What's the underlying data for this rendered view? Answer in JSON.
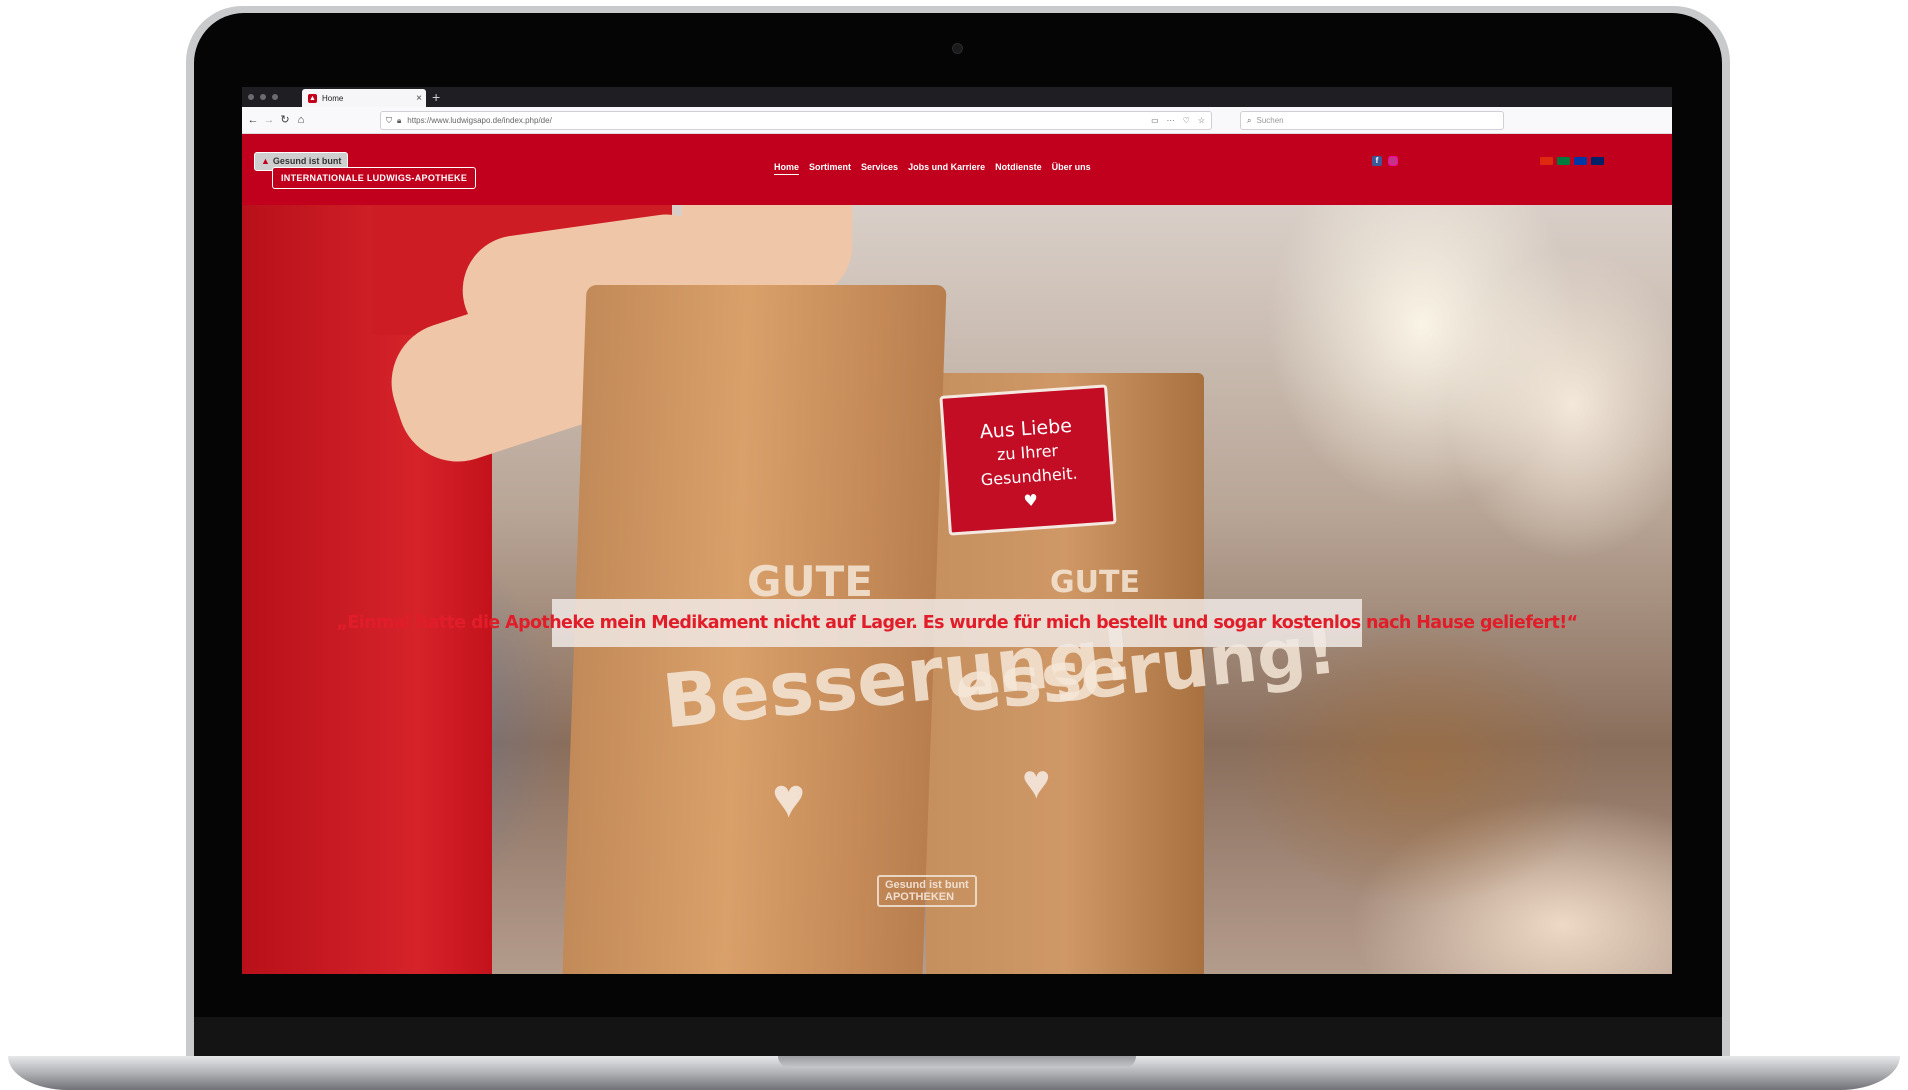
{
  "browser": {
    "tab": {
      "title": "Home",
      "close": "×",
      "new_tab": "+"
    },
    "nav": {
      "back": "←",
      "forward": "→",
      "reload": "↻",
      "home": "⌂"
    },
    "url": "https://www.ludwigsapo.de/index.php/de/",
    "url_actions": {
      "reader": "▭",
      "more": "···",
      "pocket": "♡",
      "star": "☆"
    },
    "search_placeholder": "Suchen",
    "icons": [
      "shield-icon",
      "lock-icon",
      "search-icon"
    ]
  },
  "site": {
    "logo": {
      "tagline": "Gesund ist bunt",
      "name": "INTERNATIONALE LUDWIGS-APOTHEKE"
    },
    "nav": [
      {
        "label": "Home",
        "active": true
      },
      {
        "label": "Sortiment",
        "active": false
      },
      {
        "label": "Services",
        "active": false
      },
      {
        "label": "Jobs und Karriere",
        "active": false
      },
      {
        "label": "Notdienste",
        "active": false
      },
      {
        "label": "Über uns",
        "active": false
      }
    ],
    "social": {
      "facebook": "f"
    },
    "languages": [
      {
        "code": "zh",
        "color": "#de2910"
      },
      {
        "code": "ar",
        "color": "#007a3d"
      },
      {
        "code": "ru",
        "color": "#0039a6"
      },
      {
        "code": "en",
        "color": "#012169"
      }
    ],
    "brand_color": "#c0001c"
  },
  "hero": {
    "quote": "„Einmal hatte die Apotheke mein Medikament nicht auf Lager. Es wurde für mich bestellt und sogar kostenlos nach Hause geliefert!“",
    "bag_label_line1": "Aus Liebe",
    "bag_label_line2": "zu Ihrer Gesundheit.",
    "bag_text_top": "GUTE",
    "bag_text_main": "Besserung!",
    "bag_text_back": "esserung!",
    "bag_mini_brand": "Gesund ist bunt",
    "bag_mini_sub": "APOTHEKEN",
    "quote_color": "#e21d2a"
  }
}
